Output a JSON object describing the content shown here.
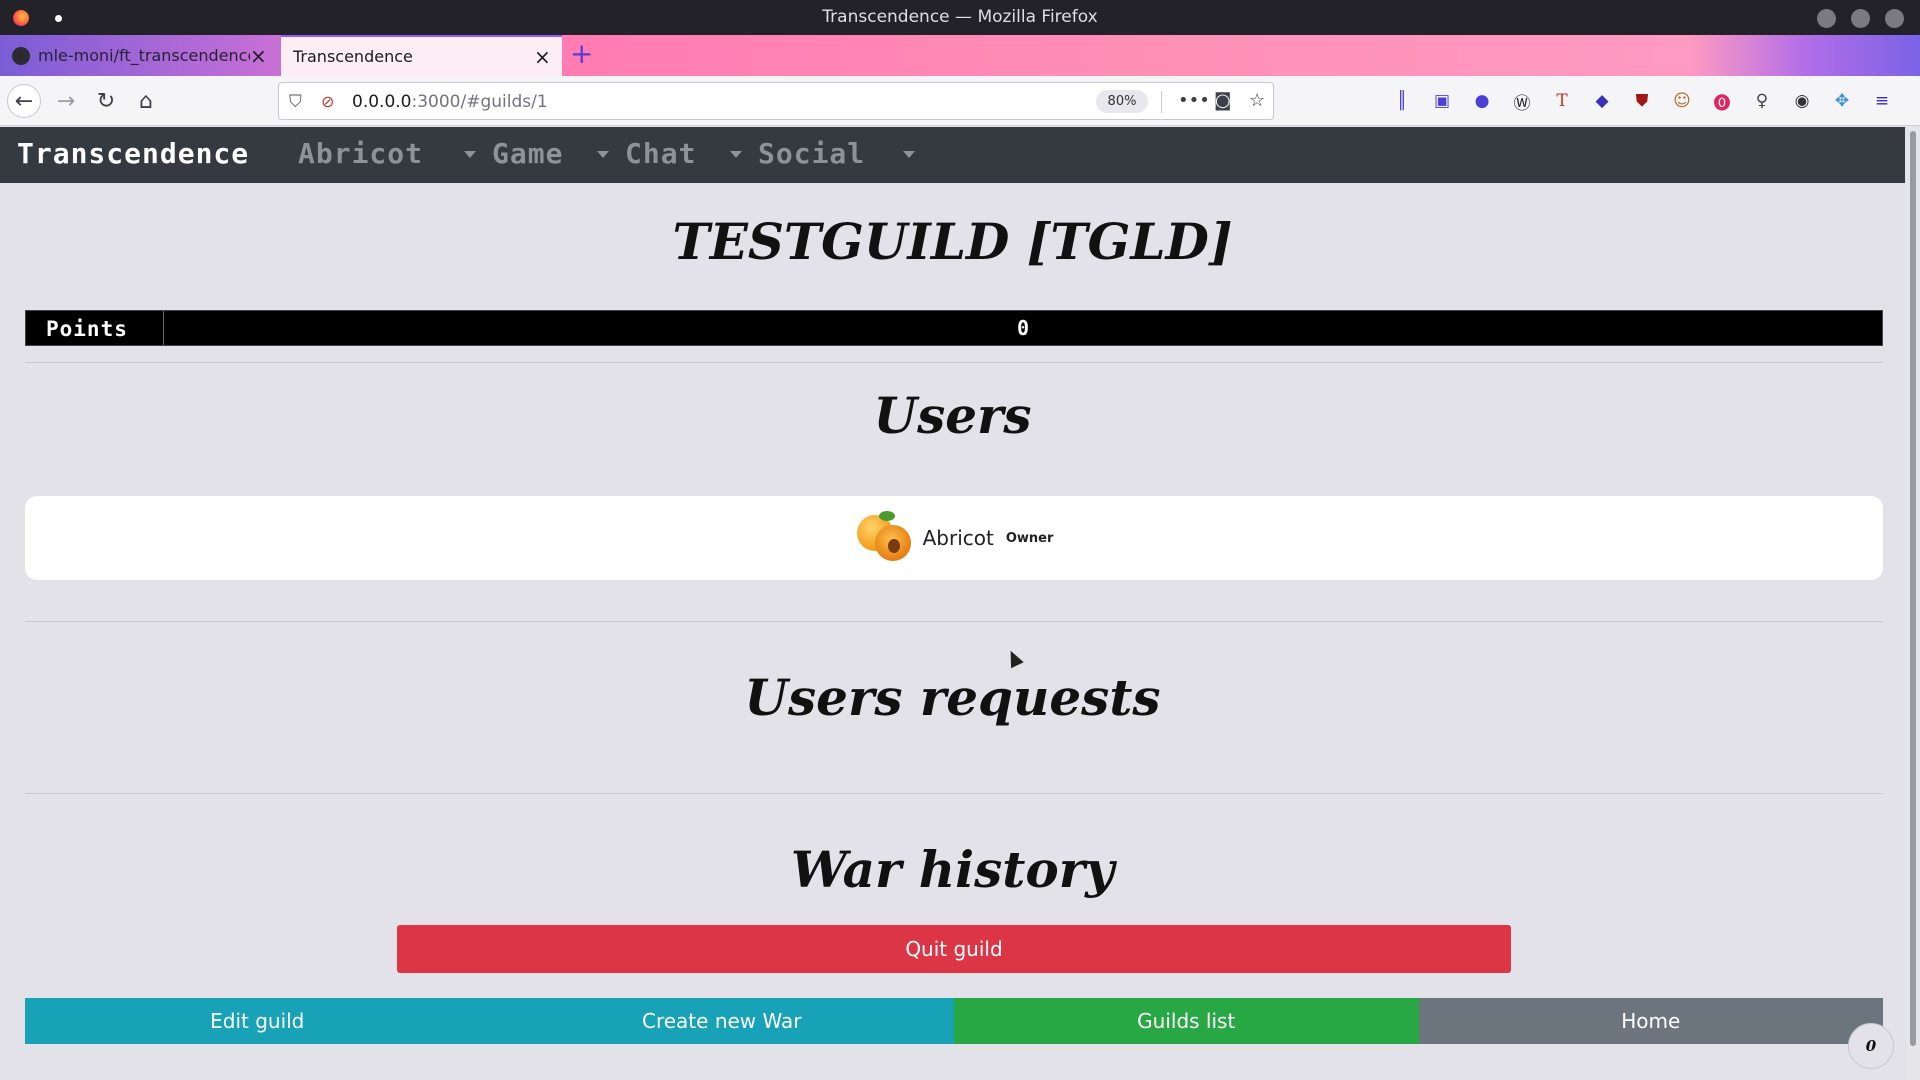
{
  "window": {
    "title": "Transcendence — Mozilla Firefox"
  },
  "tabs": [
    {
      "label": "mle-moni/ft_transcendence",
      "icon": "github-icon"
    },
    {
      "label": "Transcendence",
      "icon": "page-icon"
    }
  ],
  "browser": {
    "url_host": "0.0.0.0",
    "url_rest": ":3000/#guilds/1",
    "zoom": "80%"
  },
  "appnav": {
    "brand": "Transcendence",
    "menus": [
      "Abricot",
      "Game",
      "Chat",
      "Social"
    ]
  },
  "guild": {
    "title": "TESTGUILD [TGLD]",
    "points_label": "Points",
    "points_value": "0"
  },
  "sections": {
    "users": "Users",
    "requests": "Users requests",
    "war_history": "War history"
  },
  "members": [
    {
      "name": "Abricot",
      "role": "Owner",
      "avatar": "apricot-avatar"
    }
  ],
  "buttons": {
    "quit": "Quit guild",
    "edit": "Edit guild",
    "create_war": "Create new War",
    "guilds_list": "Guilds list",
    "home": "Home"
  },
  "notification_counter": "0",
  "colors": {
    "danger": "#dc3545",
    "info": "#17a2b8",
    "success": "#28a745",
    "secondary": "#6c757d",
    "navbar": "#343a40"
  }
}
